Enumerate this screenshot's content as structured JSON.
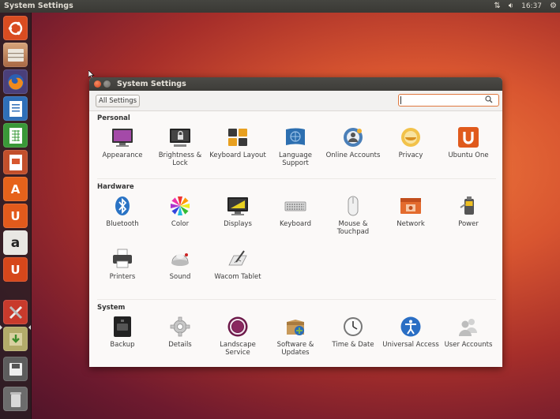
{
  "top_panel": {
    "title": "System Settings",
    "time": "16:37",
    "network_icon": "network-updown-icon",
    "volume_icon": "volume-icon",
    "session_icon": "gear-icon"
  },
  "launcher": {
    "items": [
      {
        "name": "dash",
        "color": "#d84b22",
        "glyph": "◎"
      },
      {
        "name": "files",
        "color": "#b8774a",
        "glyph": "▤"
      },
      {
        "name": "firefox",
        "color": "#e66a1d",
        "glyph": "◉"
      },
      {
        "name": "writer",
        "color": "#3d79c4",
        "glyph": "≡"
      },
      {
        "name": "calc",
        "color": "#3f9a3a",
        "glyph": "▦"
      },
      {
        "name": "impress",
        "color": "#c7502f",
        "glyph": "▣"
      },
      {
        "name": "software-center",
        "color": "#e0621c",
        "glyph": "A"
      },
      {
        "name": "ubuntu-one",
        "color": "#e0561d",
        "glyph": "U"
      },
      {
        "name": "amazon",
        "color": "#e6e6e6",
        "glyph": "a"
      },
      {
        "name": "ubuntu-one-music",
        "color": "#d8491b",
        "glyph": "U"
      },
      {
        "name": "system-settings",
        "color": "#c23a2a",
        "glyph": "✕"
      },
      {
        "name": "update-manager",
        "color": "#9e9a52",
        "glyph": "⬇"
      },
      {
        "name": "save-drive",
        "color": "#6a6a6a",
        "glyph": "▬"
      },
      {
        "name": "trash",
        "color": "#6f6f6f",
        "glyph": "▯"
      }
    ]
  },
  "window": {
    "title": "System Settings",
    "all_settings_label": "All Settings",
    "search_placeholder": "",
    "sections": [
      {
        "title": "Personal",
        "items": [
          {
            "label": "Appearance",
            "icon": "appearance-icon"
          },
          {
            "label": "Brightness & Lock",
            "icon": "brightness-lock-icon"
          },
          {
            "label": "Keyboard Layout",
            "icon": "keyboard-layout-icon"
          },
          {
            "label": "Language Support",
            "icon": "language-support-icon"
          },
          {
            "label": "Online Accounts",
            "icon": "online-accounts-icon"
          },
          {
            "label": "Privacy",
            "icon": "privacy-icon"
          },
          {
            "label": "Ubuntu One",
            "icon": "ubuntu-one-icon"
          }
        ]
      },
      {
        "title": "Hardware",
        "items": [
          {
            "label": "Bluetooth",
            "icon": "bluetooth-icon"
          },
          {
            "label": "Color",
            "icon": "color-icon"
          },
          {
            "label": "Displays",
            "icon": "displays-icon"
          },
          {
            "label": "Keyboard",
            "icon": "keyboard-icon"
          },
          {
            "label": "Mouse & Touchpad",
            "icon": "mouse-touchpad-icon"
          },
          {
            "label": "Network",
            "icon": "network-icon"
          },
          {
            "label": "Power",
            "icon": "power-icon"
          },
          {
            "label": "Printers",
            "icon": "printers-icon"
          },
          {
            "label": "Sound",
            "icon": "sound-icon"
          },
          {
            "label": "Wacom Tablet",
            "icon": "wacom-tablet-icon"
          }
        ]
      },
      {
        "title": "System",
        "items": [
          {
            "label": "Backup",
            "icon": "backup-icon"
          },
          {
            "label": "Details",
            "icon": "details-icon"
          },
          {
            "label": "Landscape Service",
            "icon": "landscape-service-icon"
          },
          {
            "label": "Software & Updates",
            "icon": "software-updates-icon"
          },
          {
            "label": "Time & Date",
            "icon": "time-date-icon"
          },
          {
            "label": "Universal Access",
            "icon": "universal-access-icon"
          },
          {
            "label": "User Accounts",
            "icon": "user-accounts-icon"
          }
        ]
      }
    ]
  },
  "colors": {
    "accent": "#e0783f",
    "panel": "#3c3b37",
    "window_bg": "#fbf9f8"
  }
}
